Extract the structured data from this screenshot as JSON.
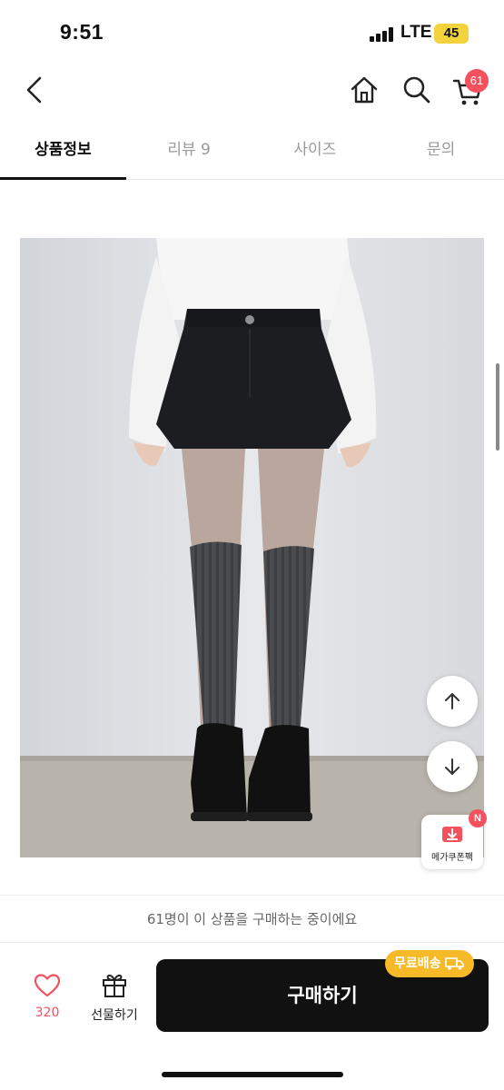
{
  "status_bar": {
    "time": "9:51",
    "network": "LTE",
    "battery": "45"
  },
  "header": {
    "back_icon": "chevron-left-icon",
    "home_icon": "home-icon",
    "search_icon": "search-icon",
    "cart_icon": "cart-icon",
    "cart_count": "61"
  },
  "tabs": [
    {
      "label": "상품정보",
      "active": true
    },
    {
      "label": "리뷰 9",
      "active": false
    },
    {
      "label": "사이즈",
      "active": false
    },
    {
      "label": "문의",
      "active": false
    }
  ],
  "floating": {
    "scroll_up_icon": "arrow-up-icon",
    "scroll_down_icon": "arrow-down-icon",
    "coupon_label": "메가쿠폰팩",
    "coupon_badge": "N"
  },
  "bottom": {
    "buying_notice": "61명이 이 상품을 구매하는 중이에요",
    "like_count": "320",
    "gift_label": "선물하기",
    "buy_label": "구매하기",
    "free_shipping": "무료배송"
  },
  "colors": {
    "accent": "#f4505e",
    "shipping": "#f6b928",
    "primary": "#111111"
  }
}
